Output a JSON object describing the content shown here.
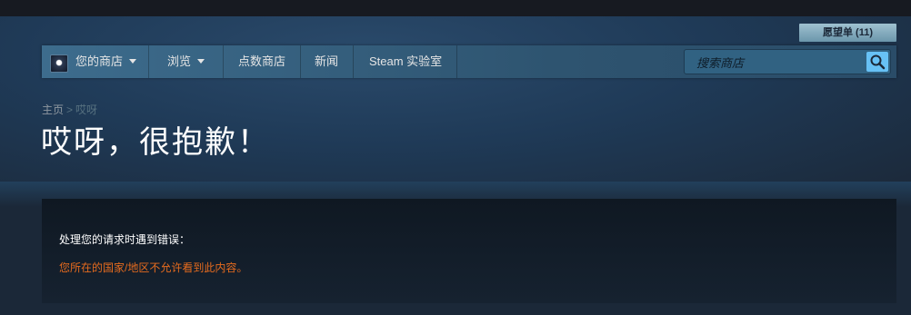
{
  "wishlist": {
    "label": "愿望单 (11)"
  },
  "nav": {
    "items": [
      {
        "label": "您的商店"
      },
      {
        "label": "浏览"
      },
      {
        "label": "点数商店"
      },
      {
        "label": "新闻"
      },
      {
        "label": "Steam 实验室"
      }
    ],
    "search_placeholder": "搜索商店"
  },
  "breadcrumb": {
    "home": "主页",
    "separator": ">",
    "current": "哎呀"
  },
  "page_title": "哎呀，很抱歉！",
  "error": {
    "heading": "处理您的请求时遇到错误：",
    "message": "您所在的国家/地区不允许看到此内容。"
  },
  "colors": {
    "accent": "#67c1f5",
    "error_text": "#e56b1e",
    "background": "#1b2838"
  }
}
